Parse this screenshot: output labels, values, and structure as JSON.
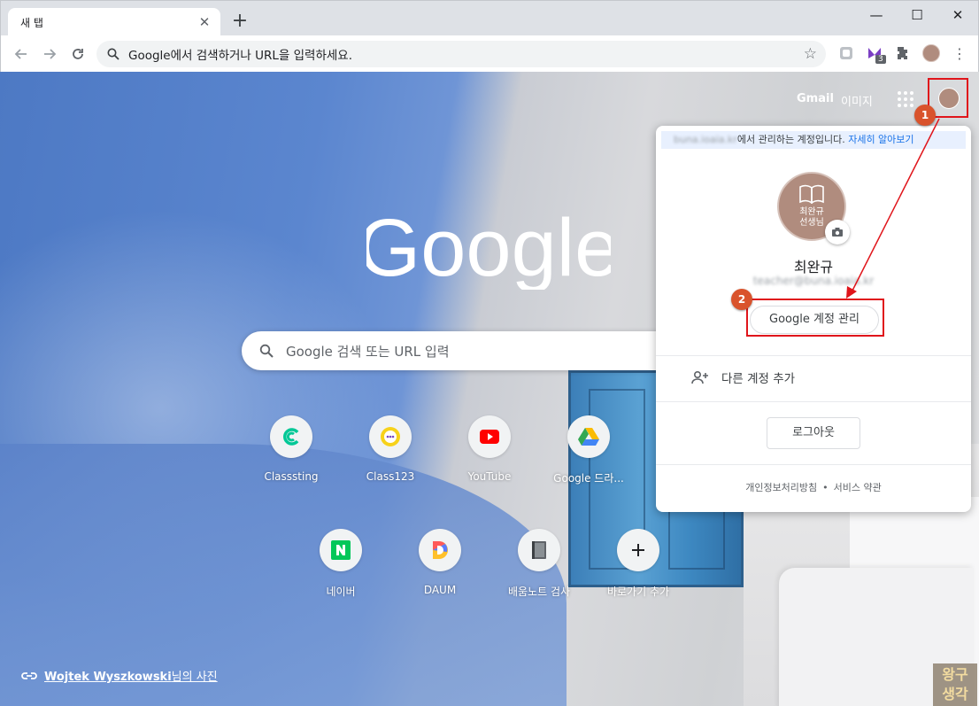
{
  "tab": {
    "title": "새 탭",
    "close_glyph": "✕",
    "newtab_glyph": "+"
  },
  "window": {
    "minimize": "—",
    "maximize": "☐",
    "close": "✕"
  },
  "omnibox": {
    "placeholder": "Google에서 검색하거나 URL을 입력하세요."
  },
  "extensions": {
    "badge_count": "3"
  },
  "ntp_header": {
    "gmail": "Gmail",
    "images": "이미지"
  },
  "logo_text": "Google",
  "search": {
    "placeholder": "Google 검색 또는 URL 입력"
  },
  "shortcuts": [
    {
      "label": "Classsting",
      "icon": "classting-icon"
    },
    {
      "label": "Class123",
      "icon": "class123-icon"
    },
    {
      "label": "YouTube",
      "icon": "youtube-icon"
    },
    {
      "label": "Google 드라...",
      "icon": "google-drive-icon"
    },
    {
      "label": "네이버",
      "icon": "naver-icon"
    },
    {
      "label": "DAUM",
      "icon": "daum-icon"
    },
    {
      "label": "배움노트 검사",
      "icon": "notebook-icon"
    },
    {
      "label": "바로가기 추가",
      "icon": "add-shortcut-icon"
    }
  ],
  "photo_credit": {
    "name": "Wojtek Wyszkowski",
    "suffix": "님의 사진"
  },
  "watermark": {
    "line1": "왕구",
    "line2": "생각"
  },
  "account_popup": {
    "managed_domain": "buna.ioaia.kr",
    "managed_text": "에서 관리하는 계정입니다.",
    "learn_more": "자세히 알아보기",
    "avatar_text_line1": "최완규",
    "avatar_text_line2": "선생님",
    "name": "최완규",
    "email": "teacher@buna.ioaia.kr",
    "manage_account": "Google 계정 관리",
    "add_account": "다른 계정 추가",
    "logout": "로그아웃",
    "privacy": "개인정보처리방침",
    "separator": "•",
    "terms": "서비스 약관"
  },
  "annotations": {
    "step1": "1",
    "step2": "2"
  },
  "colors": {
    "accent_blue": "#1a73e8",
    "annotation_red": "#e0151b",
    "badge_orange": "#d9532c"
  }
}
